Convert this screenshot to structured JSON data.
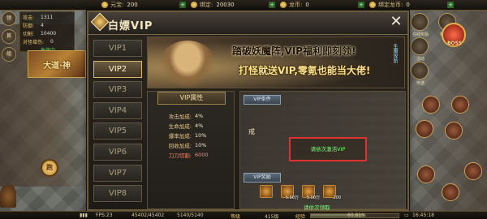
{
  "topbar": {
    "resources": [
      {
        "label": "元宝:",
        "value": "200"
      },
      {
        "label": "绑定:",
        "value": "20030"
      },
      {
        "label": "龙币:",
        "value": "0"
      },
      {
        "label": "绑定龙币:",
        "value": "0"
      }
    ]
  },
  "stats": {
    "rows": [
      {
        "k": "攻击:",
        "v": "1311"
      },
      {
        "k": "防御:",
        "v": "4"
      },
      {
        "k": "切割:",
        "v": "10400"
      },
      {
        "k": "对怪增伤:",
        "v": "0"
      },
      {
        "k": "",
        "v": "生效中"
      }
    ]
  },
  "side_icons": [
    "领",
    "首",
    "组"
  ],
  "portrait_text": "大道·神",
  "bottom_left_button": "跑",
  "right_side": {
    "icons": [
      "在线奖励",
      "特惠好礼",
      "活动",
      "传送"
    ],
    "boss_label": "BOSS"
  },
  "modal": {
    "title": "白嫖VIP",
    "close": "✕",
    "tabs": [
      "VIP1",
      "VIP2",
      "VIP3",
      "VIP4",
      "VIP5",
      "VIP6",
      "VIP7",
      "VIP8"
    ],
    "active_tab": 1,
    "banner": {
      "line1": "踏破妖魔阵,VIP福利即刻领!",
      "line2": "打怪就送VIP,零氪也能当大佬!",
      "vertical": "生魔攻防"
    },
    "attributes": {
      "heading": "VIP属性",
      "rows": [
        {
          "k": "攻击加成:",
          "v": "4%"
        },
        {
          "k": "生命加成:",
          "v": "4%"
        },
        {
          "k": "爆率加成:",
          "v": "10%"
        },
        {
          "k": "回收加成:",
          "v": "10%"
        },
        {
          "k": "刀刀切割:",
          "v": "6000",
          "red": true
        }
      ]
    },
    "content": {
      "section1": "VIP条件",
      "warrior_label": "戒",
      "activate_text": "请依次激活VIP",
      "section2": "VIP奖励",
      "rewards": [
        "",
        "5.00万",
        "5.00万",
        "200"
      ],
      "claim_text": "请依次领取"
    }
  },
  "bottombar": {
    "fps": "FPS:23",
    "hp": "45402/45402",
    "mp": "5140/5140",
    "level_label": "等级",
    "level": "415级",
    "exp_label": "经验",
    "exp": "60.81%",
    "time": "16:45:18"
  }
}
